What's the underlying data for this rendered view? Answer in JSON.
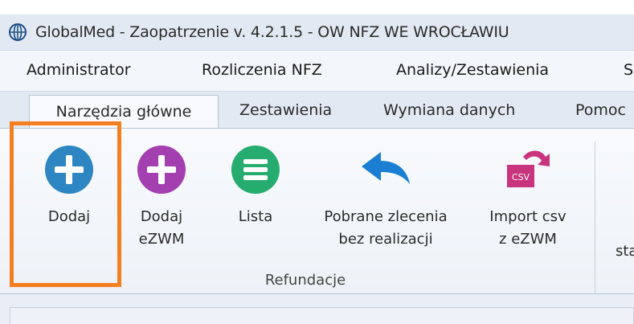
{
  "window": {
    "title": "GlobalMed - Zaopatrzenie v. 4.2.1.5 - OW NFZ WE WROCŁAWIU",
    "icon": "globe-icon"
  },
  "menu": {
    "items": [
      {
        "label": "Administrator"
      },
      {
        "label": "Rozliczenia NFZ"
      },
      {
        "label": "Analizy/Zestawienia"
      },
      {
        "label": "S"
      }
    ]
  },
  "tabs": [
    {
      "label": "Narzędzia główne",
      "active": true
    },
    {
      "label": "Zestawienia"
    },
    {
      "label": "Wymiana danych"
    },
    {
      "label": "Pomoc"
    }
  ],
  "ribbon": {
    "group_label": "Refundacje",
    "partial_label": "sta",
    "buttons": [
      {
        "line1": "Dodaj",
        "line2": "",
        "icon": "plus-circle-blue-icon",
        "color": "#2d86c1"
      },
      {
        "line1": "Dodaj",
        "line2": "eZWM",
        "icon": "plus-circle-purple-icon",
        "color": "#a43fb0"
      },
      {
        "line1": "Lista",
        "line2": "",
        "icon": "list-circle-green-icon",
        "color": "#27ac6f"
      },
      {
        "line1": "Pobrane zlecenia",
        "line2": "bez realizacji",
        "icon": "undo-arrow-icon",
        "color": "#1a7fd2"
      },
      {
        "line1": "Import csv",
        "line2": "z eZWM",
        "icon": "csv-import-icon",
        "color": "#c8357e",
        "icon_text": "CSV"
      }
    ]
  },
  "highlight_color": "#f47f20"
}
